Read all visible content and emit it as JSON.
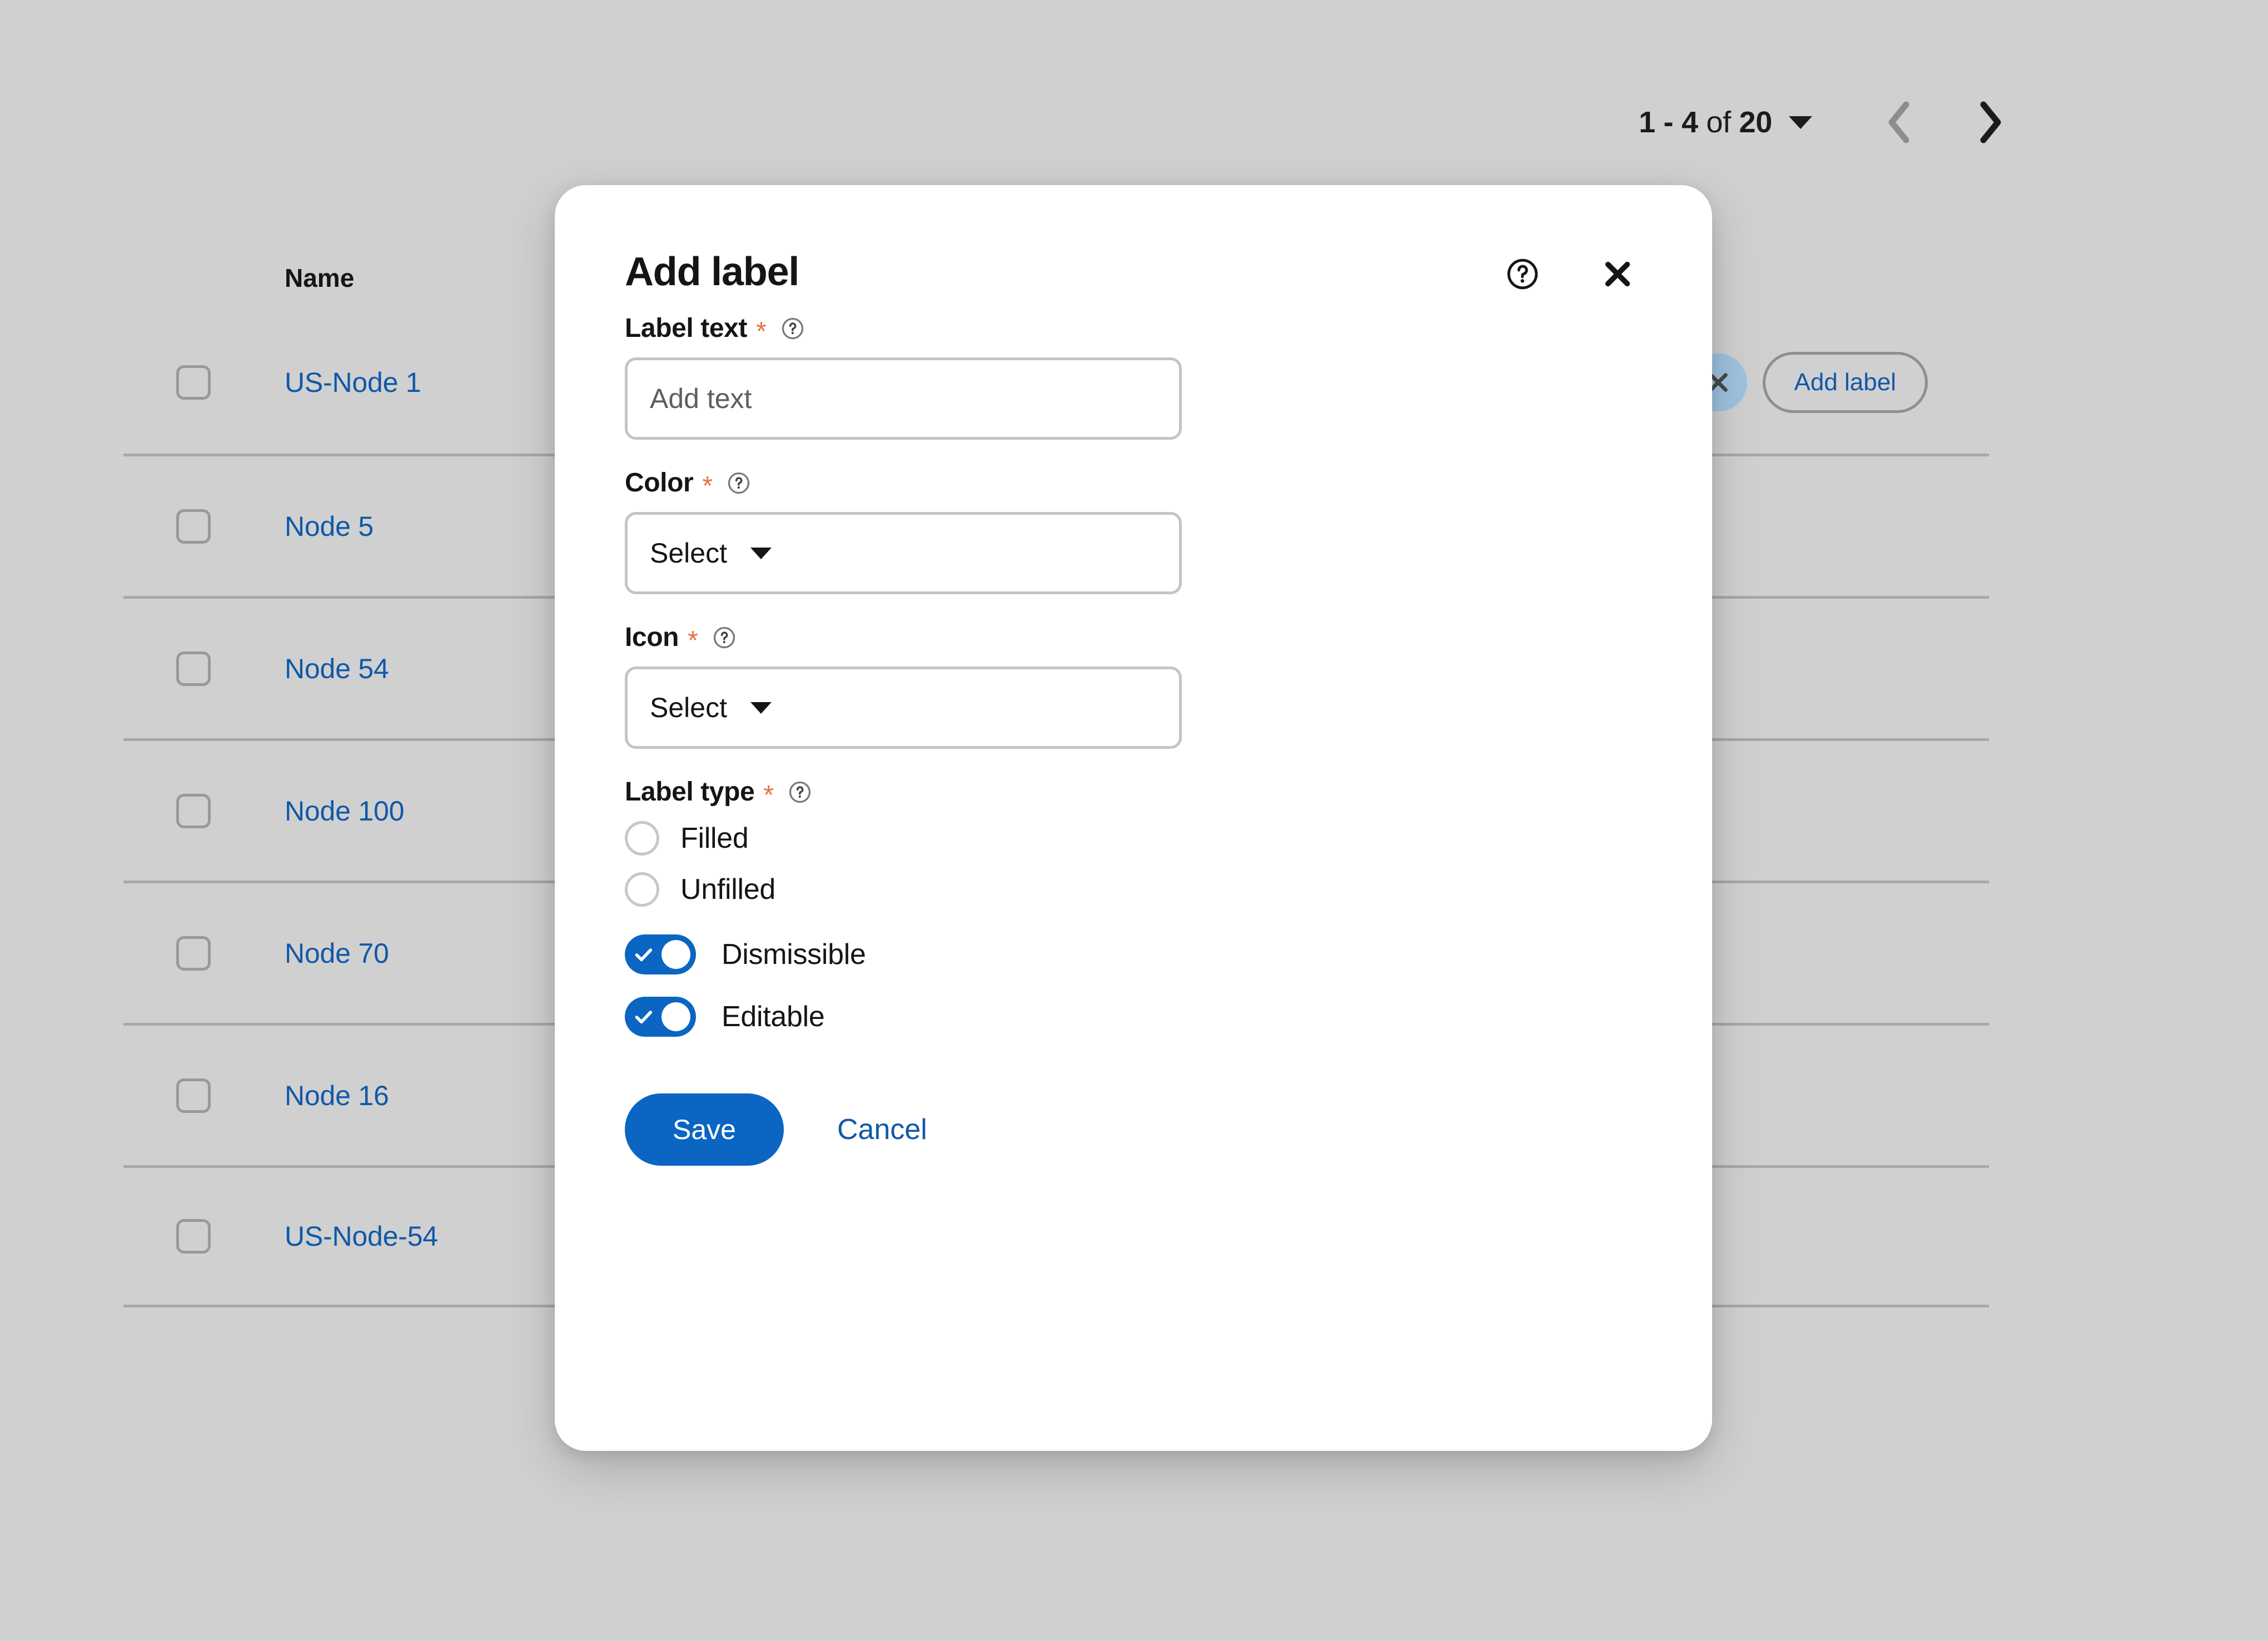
{
  "pagination": {
    "range": "1 - 4",
    "of_word": "of",
    "total": "20",
    "caret_icon": "chevron-down-icon",
    "prev_icon": "chevron-left-icon",
    "next_icon": "chevron-right-icon"
  },
  "table": {
    "columns": [
      "Name"
    ],
    "rows": [
      {
        "name": "US-Node 1",
        "has_labels": true
      },
      {
        "name": "Node 5",
        "has_labels": false
      },
      {
        "name": "Node 54",
        "has_labels": false
      },
      {
        "name": "Node 100",
        "has_labels": false
      },
      {
        "name": "Node 70",
        "has_labels": false
      },
      {
        "name": "Node 16",
        "has_labels": false
      },
      {
        "name": "US-Node-54",
        "has_labels": false
      }
    ],
    "chip": {
      "dismiss_icon": "close-icon"
    },
    "add_label_button": "Add label"
  },
  "modal": {
    "title": "Add label",
    "help_icon": "help-circle-icon",
    "close_icon": "close-icon",
    "required_marker": "*",
    "fields": {
      "label_text": {
        "label": "Label text",
        "placeholder": "Add text",
        "value": "",
        "help_icon": "help-circle-icon"
      },
      "color": {
        "label": "Color",
        "selected": "Select",
        "caret_icon": "chevron-down-icon",
        "help_icon": "help-circle-icon"
      },
      "icon": {
        "label": "Icon",
        "selected": "Select",
        "caret_icon": "chevron-down-icon",
        "help_icon": "help-circle-icon"
      },
      "label_type": {
        "label": "Label type",
        "help_icon": "help-circle-icon",
        "options": [
          {
            "label": "Filled",
            "selected": false
          },
          {
            "label": "Unfilled",
            "selected": false
          }
        ]
      },
      "toggles": [
        {
          "label": "Dismissible",
          "on": true,
          "check_icon": "check-icon"
        },
        {
          "label": "Editable",
          "on": true,
          "check_icon": "check-icon"
        }
      ]
    },
    "footer": {
      "save_label": "Save",
      "cancel_label": "Cancel"
    }
  },
  "colors": {
    "page_background": "#d0d0d0",
    "modal_background": "#ffffff",
    "accent_blue": "#0a66c2",
    "link_blue": "#1158a8",
    "required_orange": "#e8704a",
    "chip_blue": "#9fc3e0",
    "border_gray": "#c4c4c4",
    "divider_gray": "#a8a8a8"
  }
}
